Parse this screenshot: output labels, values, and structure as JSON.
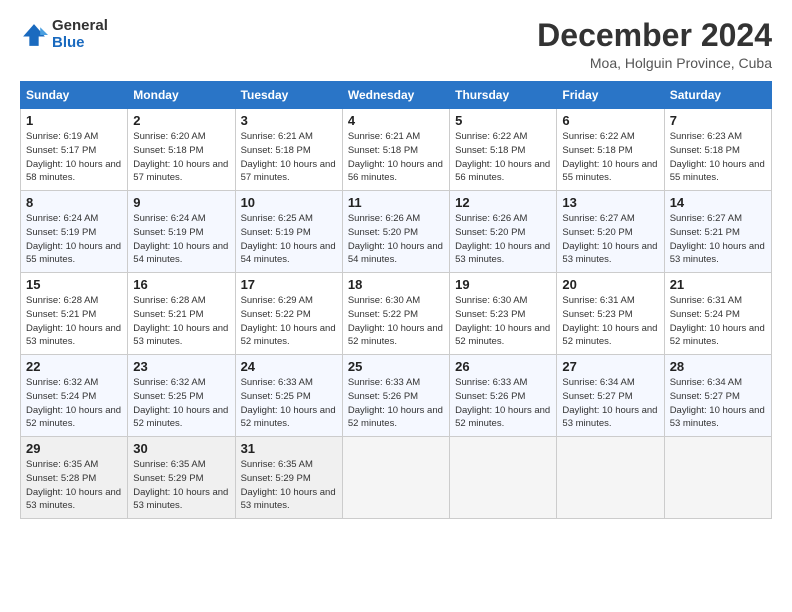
{
  "header": {
    "logo_general": "General",
    "logo_blue": "Blue",
    "title": "December 2024",
    "subtitle": "Moa, Holguin Province, Cuba"
  },
  "days_of_week": [
    "Sunday",
    "Monday",
    "Tuesday",
    "Wednesday",
    "Thursday",
    "Friday",
    "Saturday"
  ],
  "weeks": [
    [
      {
        "day": "1",
        "info": "Sunrise: 6:19 AM\nSunset: 5:17 PM\nDaylight: 10 hours\nand 58 minutes."
      },
      {
        "day": "2",
        "info": "Sunrise: 6:20 AM\nSunset: 5:18 PM\nDaylight: 10 hours\nand 57 minutes."
      },
      {
        "day": "3",
        "info": "Sunrise: 6:21 AM\nSunset: 5:18 PM\nDaylight: 10 hours\nand 57 minutes."
      },
      {
        "day": "4",
        "info": "Sunrise: 6:21 AM\nSunset: 5:18 PM\nDaylight: 10 hours\nand 56 minutes."
      },
      {
        "day": "5",
        "info": "Sunrise: 6:22 AM\nSunset: 5:18 PM\nDaylight: 10 hours\nand 56 minutes."
      },
      {
        "day": "6",
        "info": "Sunrise: 6:22 AM\nSunset: 5:18 PM\nDaylight: 10 hours\nand 55 minutes."
      },
      {
        "day": "7",
        "info": "Sunrise: 6:23 AM\nSunset: 5:18 PM\nDaylight: 10 hours\nand 55 minutes."
      }
    ],
    [
      {
        "day": "8",
        "info": "Sunrise: 6:24 AM\nSunset: 5:19 PM\nDaylight: 10 hours\nand 55 minutes."
      },
      {
        "day": "9",
        "info": "Sunrise: 6:24 AM\nSunset: 5:19 PM\nDaylight: 10 hours\nand 54 minutes."
      },
      {
        "day": "10",
        "info": "Sunrise: 6:25 AM\nSunset: 5:19 PM\nDaylight: 10 hours\nand 54 minutes."
      },
      {
        "day": "11",
        "info": "Sunrise: 6:26 AM\nSunset: 5:20 PM\nDaylight: 10 hours\nand 54 minutes."
      },
      {
        "day": "12",
        "info": "Sunrise: 6:26 AM\nSunset: 5:20 PM\nDaylight: 10 hours\nand 53 minutes."
      },
      {
        "day": "13",
        "info": "Sunrise: 6:27 AM\nSunset: 5:20 PM\nDaylight: 10 hours\nand 53 minutes."
      },
      {
        "day": "14",
        "info": "Sunrise: 6:27 AM\nSunset: 5:21 PM\nDaylight: 10 hours\nand 53 minutes."
      }
    ],
    [
      {
        "day": "15",
        "info": "Sunrise: 6:28 AM\nSunset: 5:21 PM\nDaylight: 10 hours\nand 53 minutes."
      },
      {
        "day": "16",
        "info": "Sunrise: 6:28 AM\nSunset: 5:21 PM\nDaylight: 10 hours\nand 53 minutes."
      },
      {
        "day": "17",
        "info": "Sunrise: 6:29 AM\nSunset: 5:22 PM\nDaylight: 10 hours\nand 52 minutes."
      },
      {
        "day": "18",
        "info": "Sunrise: 6:30 AM\nSunset: 5:22 PM\nDaylight: 10 hours\nand 52 minutes."
      },
      {
        "day": "19",
        "info": "Sunrise: 6:30 AM\nSunset: 5:23 PM\nDaylight: 10 hours\nand 52 minutes."
      },
      {
        "day": "20",
        "info": "Sunrise: 6:31 AM\nSunset: 5:23 PM\nDaylight: 10 hours\nand 52 minutes."
      },
      {
        "day": "21",
        "info": "Sunrise: 6:31 AM\nSunset: 5:24 PM\nDaylight: 10 hours\nand 52 minutes."
      }
    ],
    [
      {
        "day": "22",
        "info": "Sunrise: 6:32 AM\nSunset: 5:24 PM\nDaylight: 10 hours\nand 52 minutes."
      },
      {
        "day": "23",
        "info": "Sunrise: 6:32 AM\nSunset: 5:25 PM\nDaylight: 10 hours\nand 52 minutes."
      },
      {
        "day": "24",
        "info": "Sunrise: 6:33 AM\nSunset: 5:25 PM\nDaylight: 10 hours\nand 52 minutes."
      },
      {
        "day": "25",
        "info": "Sunrise: 6:33 AM\nSunset: 5:26 PM\nDaylight: 10 hours\nand 52 minutes."
      },
      {
        "day": "26",
        "info": "Sunrise: 6:33 AM\nSunset: 5:26 PM\nDaylight: 10 hours\nand 52 minutes."
      },
      {
        "day": "27",
        "info": "Sunrise: 6:34 AM\nSunset: 5:27 PM\nDaylight: 10 hours\nand 53 minutes."
      },
      {
        "day": "28",
        "info": "Sunrise: 6:34 AM\nSunset: 5:27 PM\nDaylight: 10 hours\nand 53 minutes."
      }
    ],
    [
      {
        "day": "29",
        "info": "Sunrise: 6:35 AM\nSunset: 5:28 PM\nDaylight: 10 hours\nand 53 minutes."
      },
      {
        "day": "30",
        "info": "Sunrise: 6:35 AM\nSunset: 5:29 PM\nDaylight: 10 hours\nand 53 minutes."
      },
      {
        "day": "31",
        "info": "Sunrise: 6:35 AM\nSunset: 5:29 PM\nDaylight: 10 hours\nand 53 minutes."
      },
      {
        "day": "",
        "info": ""
      },
      {
        "day": "",
        "info": ""
      },
      {
        "day": "",
        "info": ""
      },
      {
        "day": "",
        "info": ""
      }
    ]
  ]
}
